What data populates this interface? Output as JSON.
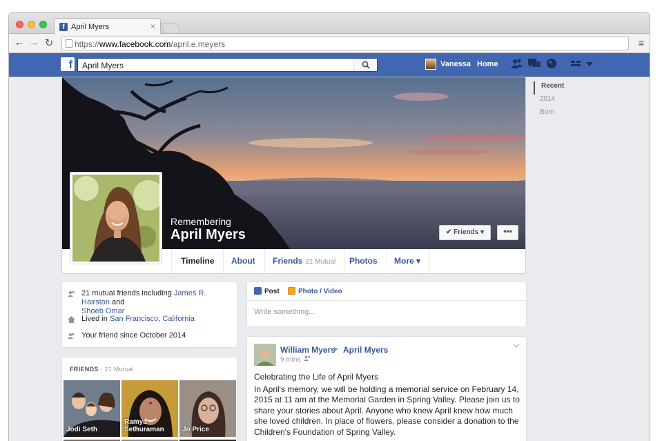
{
  "browser": {
    "tab_title": "April Myers",
    "tab_close": "×",
    "favicon": "f",
    "url_scheme": "https://",
    "url_host": "www.facebook.com",
    "url_path": "/april.e.meyers",
    "back_icon": "←",
    "forward_icon": "→",
    "reload_icon": "↻",
    "menu_icon": "≡"
  },
  "fbbar": {
    "logo": "f",
    "search_value": "April Myers",
    "search_icon": "🔍",
    "user_name": "Vanessa",
    "home_label": "Home",
    "brand_color": "#4267b2"
  },
  "profile": {
    "remembering": "Remembering",
    "name": "April Myers",
    "friends_button": "✔ Friends ▾",
    "more_button": "•••"
  },
  "nav": {
    "timeline": "Timeline",
    "about": "About",
    "friends": "Friends",
    "friends_mutual": "21 Mutual",
    "photos": "Photos",
    "more": "More ▾"
  },
  "years": [
    "Recent",
    "2014",
    "Born"
  ],
  "intro": {
    "mutual_prefix": "21 mutual friends including ",
    "mutual_link1": "James R. Hairston",
    "mutual_and": " and",
    "mutual_link2": "Shoeb Omar",
    "lived_prefix": "Lived in ",
    "lived_city": "San Francisco",
    "lived_sep": ", ",
    "lived_state": "California",
    "friend_since": "Your friend since October 2014"
  },
  "friends_box": {
    "heading": "FRIENDS",
    "mutual": " · 21 Mutual",
    "tiles": [
      {
        "name": "Jodi Seth"
      },
      {
        "name": "Ramya\nSethuraman"
      },
      {
        "name": "Jo Price"
      }
    ]
  },
  "composer": {
    "tab_post": "Post",
    "tab_photo": "Photo / Video",
    "placeholder": "Write something..."
  },
  "post": {
    "author": "William Myers",
    "arrow": "▶",
    "target": "April Myers",
    "time": "9 mins ·",
    "heading": "Celebrating the Life of April Myers",
    "body": "In April's memory, we will be holding a memorial service on February 14, 2015 at 11 am at the Memorial Garden in Spring Valley. Please join us to share your stories about April. Anyone who knew April knew how much she loved children. In place of flowers, please consider a donation to the Children's Foundation of Spring Valley."
  }
}
